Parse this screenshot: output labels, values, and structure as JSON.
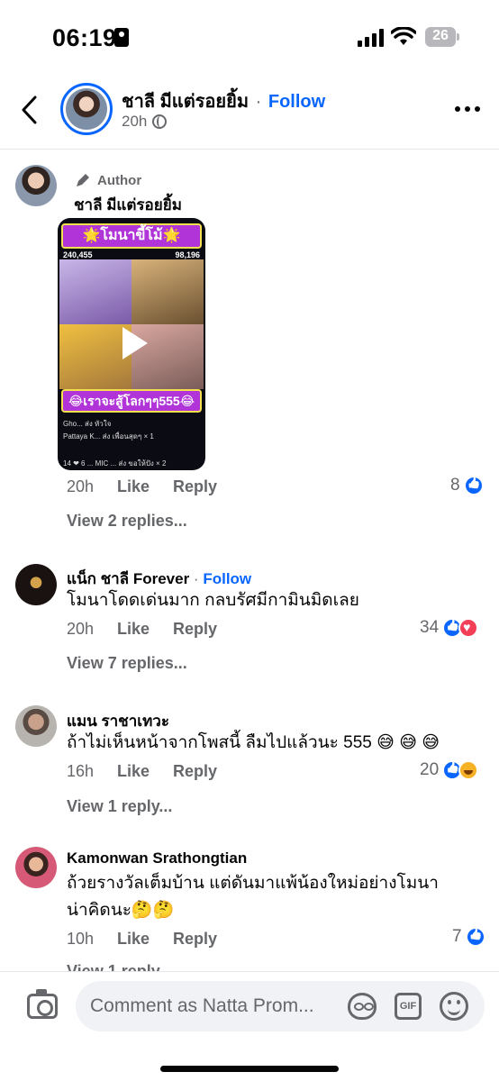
{
  "status_bar": {
    "time": "06:19",
    "battery": "26"
  },
  "header": {
    "name": "ชาลี มีแต่รอยยิ้ม",
    "separator": "·",
    "follow_label": "Follow",
    "timestamp": "20h"
  },
  "comments": [
    {
      "badge": "Author",
      "name": "ชาลี มีแต่รอยยิ้ม",
      "video": {
        "title": "🌟โมนาขี้โม้🌟",
        "score_left": "240,455",
        "score_right": "98,196",
        "banner": "😂เราจะสู้โลกๆๆ555😂",
        "chat_1": "Gho... ส่ง หัวใจ",
        "chat_2": "Pattaya K... ส่ง เพื่อนสุดๆ × 1",
        "chat_3": "14 ❤ 6 ... MIC ... ส่ง ขอให้ปัง × 2"
      },
      "time": "20h",
      "like_label": "Like",
      "reply_label": "Reply",
      "reaction_count": "8",
      "replies_label": "View 2 replies..."
    },
    {
      "name": "แน็ก ชาลี Forever",
      "separator": "·",
      "follow_label": "Follow",
      "text": "โมนาโดดเด่นมาก กลบรัศมีกามินมิดเลย",
      "time": "20h",
      "like_label": "Like",
      "reply_label": "Reply",
      "reaction_count": "34",
      "replies_label": "View 7 replies..."
    },
    {
      "name": "แมน ราชาเทวะ",
      "text": "ถ้าไม่เห็นหน้าจากโพสนี้ ลืมไปแล้วนะ 555 😅 😅 😅",
      "time": "16h",
      "like_label": "Like",
      "reply_label": "Reply",
      "reaction_count": "20",
      "replies_label": "View 1 reply..."
    },
    {
      "name": "Kamonwan Srathongtian",
      "text_line1": "ถ้วยรางวัลเต็มบ้าน แต่ดันมาแพ้น้องใหม่อย่างโมนา",
      "text_line2": "น่าคิดนะ🤔🤔",
      "time": "10h",
      "like_label": "Like",
      "reply_label": "Reply",
      "reaction_count": "7",
      "replies_label": "View 1 reply..."
    }
  ],
  "composer": {
    "placeholder": "Comment as Natta Prom...",
    "gif_label": "GIF"
  },
  "colors": {
    "accent": "#0866ff",
    "secondary_text": "#65676b",
    "love": "#f33e58",
    "haha": "#f7b125"
  },
  "icons": [
    "id-card-icon",
    "signal-icon",
    "wifi-icon",
    "battery-icon",
    "back-arrow-icon",
    "globe-icon",
    "more-icon",
    "pen-icon",
    "play-icon",
    "like-reaction-icon",
    "love-reaction-icon",
    "haha-reaction-icon",
    "camera-icon",
    "avatar-sticker-icon",
    "gif-icon",
    "emoji-icon"
  ]
}
